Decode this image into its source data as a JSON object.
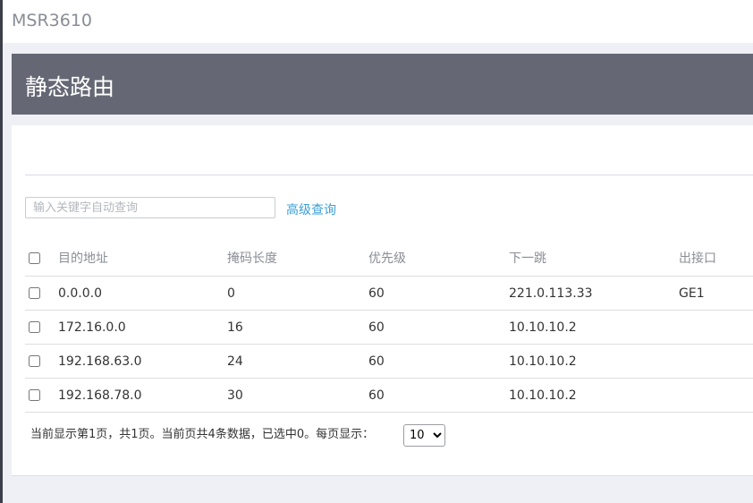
{
  "app": {
    "title": "MSR3610"
  },
  "page": {
    "title": "静态路由"
  },
  "search": {
    "placeholder": "输入关键字自动查询",
    "value": "",
    "advanced_label": "高级查询"
  },
  "table": {
    "columns": [
      "目的地址",
      "掩码长度",
      "优先级",
      "下一跳",
      "出接口"
    ],
    "rows": [
      {
        "dest": "0.0.0.0",
        "mask": "0",
        "priority": "60",
        "next_hop": "221.0.113.33",
        "iface": "GE1"
      },
      {
        "dest": "172.16.0.0",
        "mask": "16",
        "priority": "60",
        "next_hop": "10.10.10.2",
        "iface": ""
      },
      {
        "dest": "192.168.63.0",
        "mask": "24",
        "priority": "60",
        "next_hop": "10.10.10.2",
        "iface": ""
      },
      {
        "dest": "192.168.78.0",
        "mask": "30",
        "priority": "60",
        "next_hop": "10.10.10.2",
        "iface": ""
      }
    ]
  },
  "pagination": {
    "summary": "当前显示第1页，共1页。当前页共4条数据，已选中0。每页显示：",
    "page_size": "10"
  }
}
